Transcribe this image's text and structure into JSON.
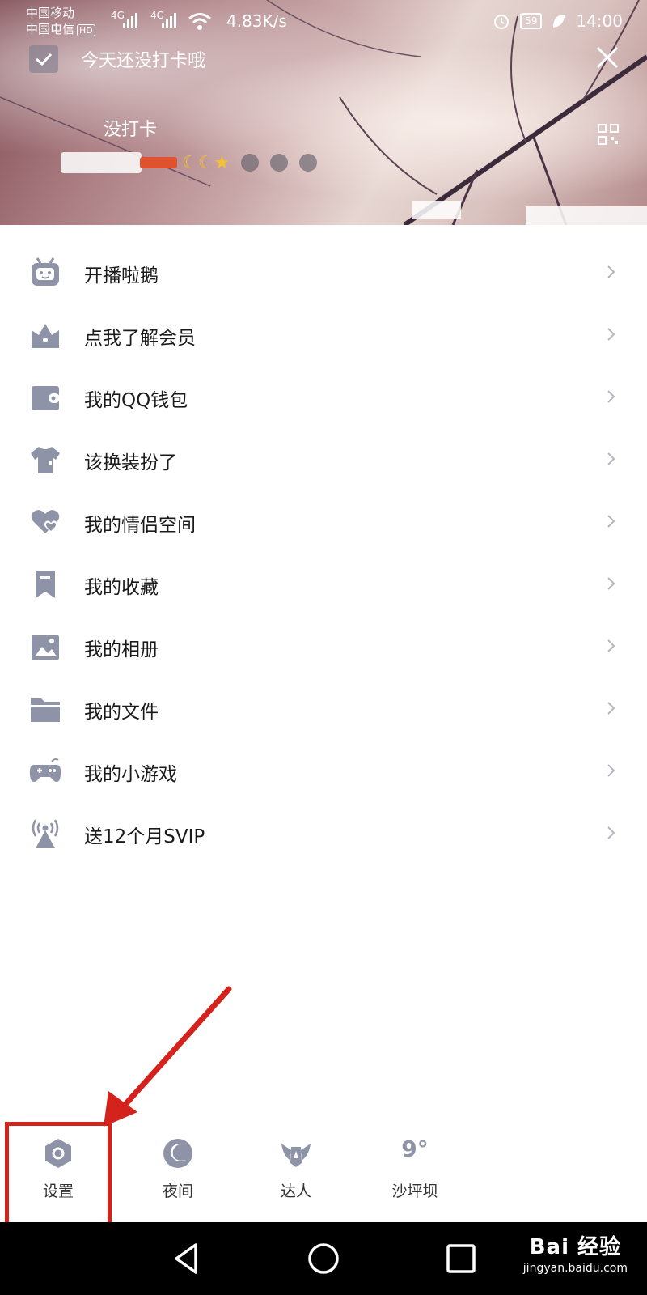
{
  "status_bar": {
    "carrier_1": "中国移动",
    "carrier_2": "中国电信",
    "hd_badge": "HD",
    "network_1": "4G",
    "network_2": "4G",
    "speed": "4.83K/s",
    "battery": "59",
    "time": "14:00"
  },
  "header": {
    "checkin_text": "今天还没打卡哦",
    "status_text": "没打卡"
  },
  "menu": {
    "items": [
      {
        "label": "开播啦鹅",
        "icon": "robot-tv-icon"
      },
      {
        "label": "点我了解会员",
        "icon": "crown-icon"
      },
      {
        "label": "我的QQ钱包",
        "icon": "wallet-icon"
      },
      {
        "label": "该换装扮了",
        "icon": "tshirt-icon"
      },
      {
        "label": "我的情侣空间",
        "icon": "hearts-icon"
      },
      {
        "label": "我的收藏",
        "icon": "bookmark-icon"
      },
      {
        "label": "我的相册",
        "icon": "photo-icon"
      },
      {
        "label": "我的文件",
        "icon": "folder-icon"
      },
      {
        "label": "我的小游戏",
        "icon": "gamepad-icon"
      },
      {
        "label": "送12个月SVIP",
        "icon": "broadcast-icon"
      }
    ]
  },
  "quick_bar": {
    "settings_label": "设置",
    "night_label": "夜间",
    "expert_label": "达人",
    "weather_temp": "9°",
    "weather_location": "沙坪坝"
  },
  "watermark": {
    "main": "Bai 经验",
    "sub": "jingyan.baidu.com"
  },
  "colors": {
    "icon_gray": "#8f93a8",
    "highlight_red": "#d3231c",
    "text_dark": "#1a1a1a"
  }
}
